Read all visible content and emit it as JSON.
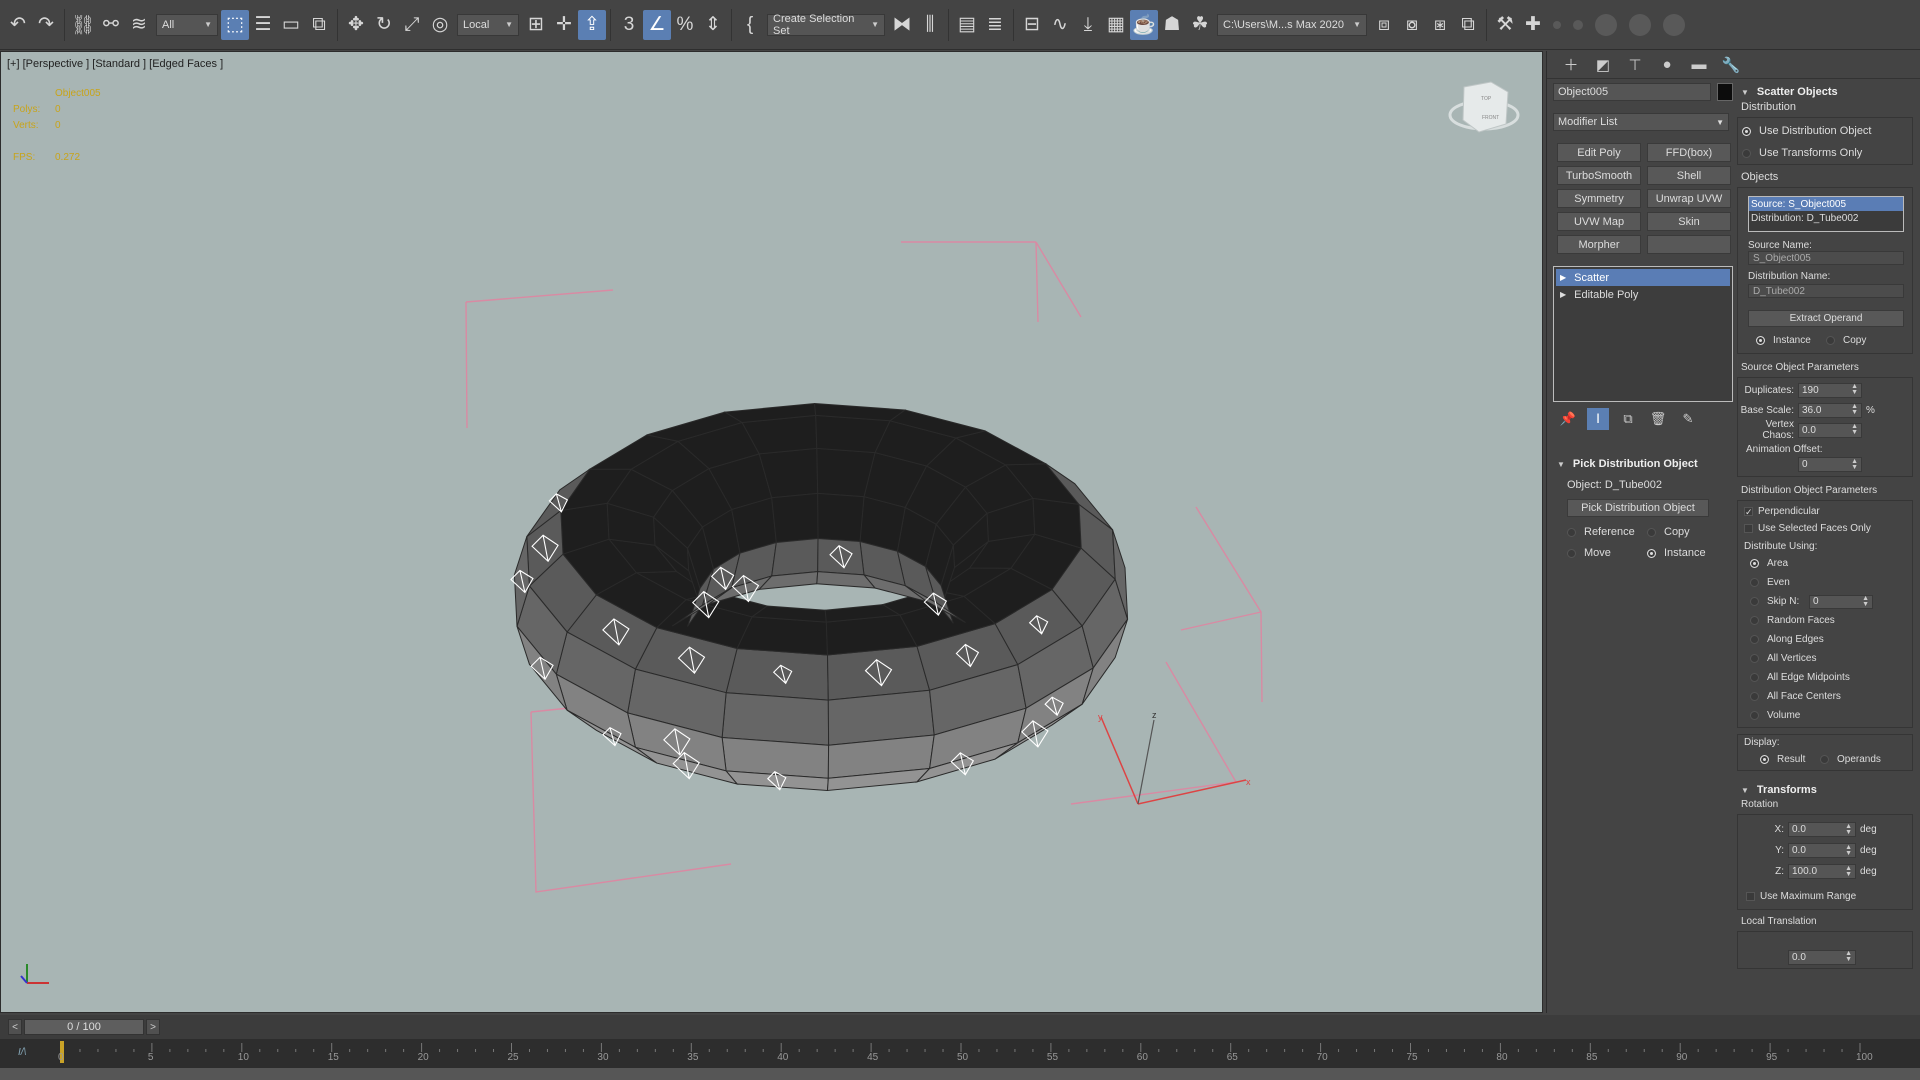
{
  "toolbar": {
    "selection_filter": "All",
    "ref_coord": "Local",
    "named_selection": "Create Selection Set",
    "project_path": "C:\\Users\\M...s Max 2020"
  },
  "viewport": {
    "label": "[+] [Perspective ] [Standard ] [Edged Faces ]",
    "stats": {
      "object_name": "Object005",
      "polys_label": "Polys:",
      "polys_value": "0",
      "verts_label": "Verts:",
      "verts_value": "0",
      "fps_label": "FPS:",
      "fps_value": "0.272"
    },
    "viewcube_top": "TOP",
    "viewcube_front": "FRONT",
    "gizmo_x": "x",
    "gizmo_y": "y",
    "gizmo_z": "z"
  },
  "command_panel": {
    "object_name": "Object005",
    "object_color": "#0c0c0c",
    "modifier_list": "Modifier List",
    "modifier_buttons": [
      "Edit Poly",
      "FFD(box)",
      "TurboSmooth",
      "Shell",
      "Symmetry",
      "Unwrap UVW",
      "UVW Map",
      "Skin",
      "Morpher",
      ""
    ],
    "stack": [
      "Scatter",
      "Editable Poly"
    ],
    "pick_distribution": {
      "title": "Pick Distribution Object",
      "object_label": "Object: D_Tube002",
      "button": "Pick Distribution Object",
      "reference": "Reference",
      "copy": "Copy",
      "move": "Move",
      "instance": "Instance"
    },
    "scatter_objects": {
      "title": "Scatter Objects",
      "distribution_label": "Distribution",
      "use_distribution_object": "Use Distribution Object",
      "use_transforms_only": "Use Transforms Only",
      "objects_label": "Objects",
      "objects_list": [
        "Source: S_Object005",
        "Distribution: D_Tube002"
      ],
      "source_name_label": "Source Name:",
      "source_name": "S_Object005",
      "distribution_name_label": "Distribution Name:",
      "distribution_name": "D_Tube002",
      "extract_operand": "Extract Operand",
      "instance": "Instance",
      "copy": "Copy",
      "source_params_label": "Source Object Parameters",
      "duplicates_label": "Duplicates:",
      "duplicates": "190",
      "base_scale_label": "Base Scale:",
      "base_scale": "36.0",
      "base_scale_unit": "%",
      "vertex_chaos_label": "Vertex Chaos:",
      "vertex_chaos": "0.0",
      "animation_offset_label": "Animation Offset:",
      "animation_offset": "0",
      "dist_params_label": "Distribution Object Parameters",
      "perpendicular": "Perpendicular",
      "use_selected_faces_only": "Use Selected Faces Only",
      "distribute_using_label": "Distribute Using:",
      "distribute_options": [
        "Area",
        "Even",
        "Skip N:",
        "Random Faces",
        "Along Edges",
        "All Vertices",
        "All Edge Midpoints",
        "All Face Centers",
        "Volume"
      ],
      "skip_n": "0",
      "display_label": "Display:",
      "result": "Result",
      "operands": "Operands"
    },
    "transforms": {
      "title": "Transforms",
      "rotation_label": "Rotation",
      "x_label": "X:",
      "x": "0.0",
      "y_label": "Y:",
      "y": "0.0",
      "z_label": "Z:",
      "z": "100.0",
      "unit": "deg",
      "use_maximum_range": "Use Maximum Range",
      "local_translation": "Local Translation",
      "lt_value": "0.0"
    }
  },
  "timeline": {
    "frame_display": "0 / 100",
    "ticks": [
      "0",
      "5",
      "10",
      "15",
      "20",
      "25",
      "30",
      "35",
      "40",
      "45",
      "50",
      "55",
      "60",
      "65",
      "70",
      "75",
      "80",
      "85",
      "90",
      "95",
      "100"
    ]
  }
}
